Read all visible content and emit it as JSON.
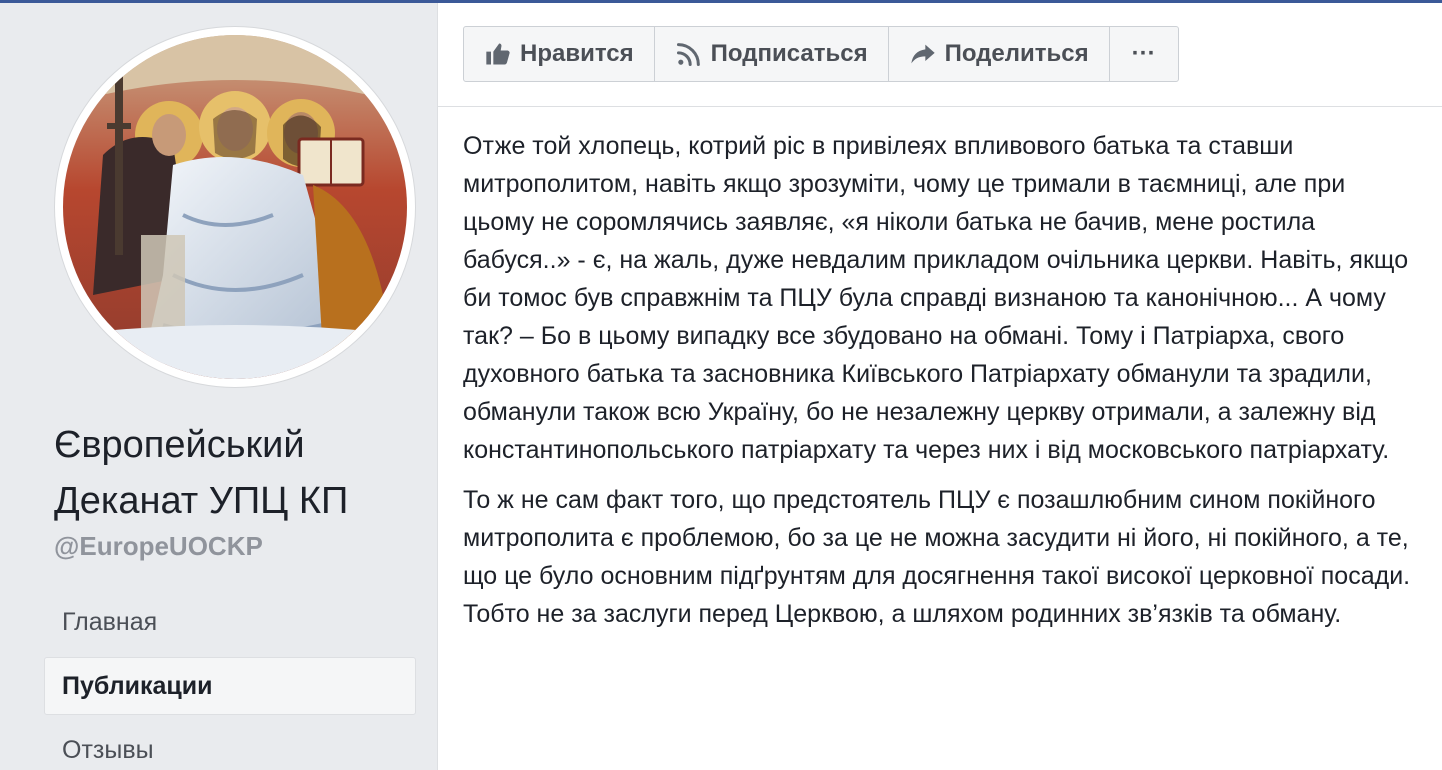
{
  "page": {
    "title": "Європейський Деканат УПЦ КП",
    "handle": "@EuropeUOCKP"
  },
  "avatar": {
    "icon": "avatar-icon",
    "description_colors": [
      "#a8352a",
      "#e6ecf4",
      "#3b2a22"
    ]
  },
  "sidebar": {
    "items": [
      {
        "label": "Главная",
        "active": false
      },
      {
        "label": "Публикации",
        "active": true
      },
      {
        "label": "Отзывы",
        "active": false
      }
    ]
  },
  "actions": {
    "like": {
      "label": "Нравится",
      "icon": "thumbs-up-icon"
    },
    "follow": {
      "label": "Подписаться",
      "icon": "rss-icon"
    },
    "share": {
      "label": "Поделиться",
      "icon": "share-arrow-icon"
    },
    "more": {
      "label": "···",
      "icon": "more-dots-icon"
    }
  },
  "post": {
    "paragraphs": [
      "Отже той хлопець, котрий ріс в привілеях впливового батька та ставши митрополитом, навіть якщо зрозуміти, чому це тримали в таємниці, але при цьому не соромлячись заявляє, «я ніколи батька не бачив, мене ростила бабуся..» - є, на жаль, дуже невдалим прикладом очільника церкви. Навіть, якщо би томос був справжнім та ПЦУ була справді визнаною та канонічною... А чому так? – Бо в цьому випадку все збудовано на обмані. Тому і Патріарха, свого духовного батька та засновника Київського Патріархату обманули та зрадили, обманули також всю Україну, бо не незалежну церкву отримали, а залежну від константинопольського патріархату та через них і від московського патріархату.",
      "То ж не сам факт того, що предстоятель ПЦУ є позашлюбним сином покійного митрополита є проблемою, бо за це не можна засудити ні його, ні покійного, а те, що це було основним підґрунтям для досягнення такої високої церковної посади. Тобто не за заслуги перед Церквою, а шляхом родинних зв’язків та обману."
    ]
  },
  "colors": {
    "brand": "#3b5998",
    "background": "#e9ebee",
    "text": "#1d2129",
    "muted": "#90949c"
  }
}
